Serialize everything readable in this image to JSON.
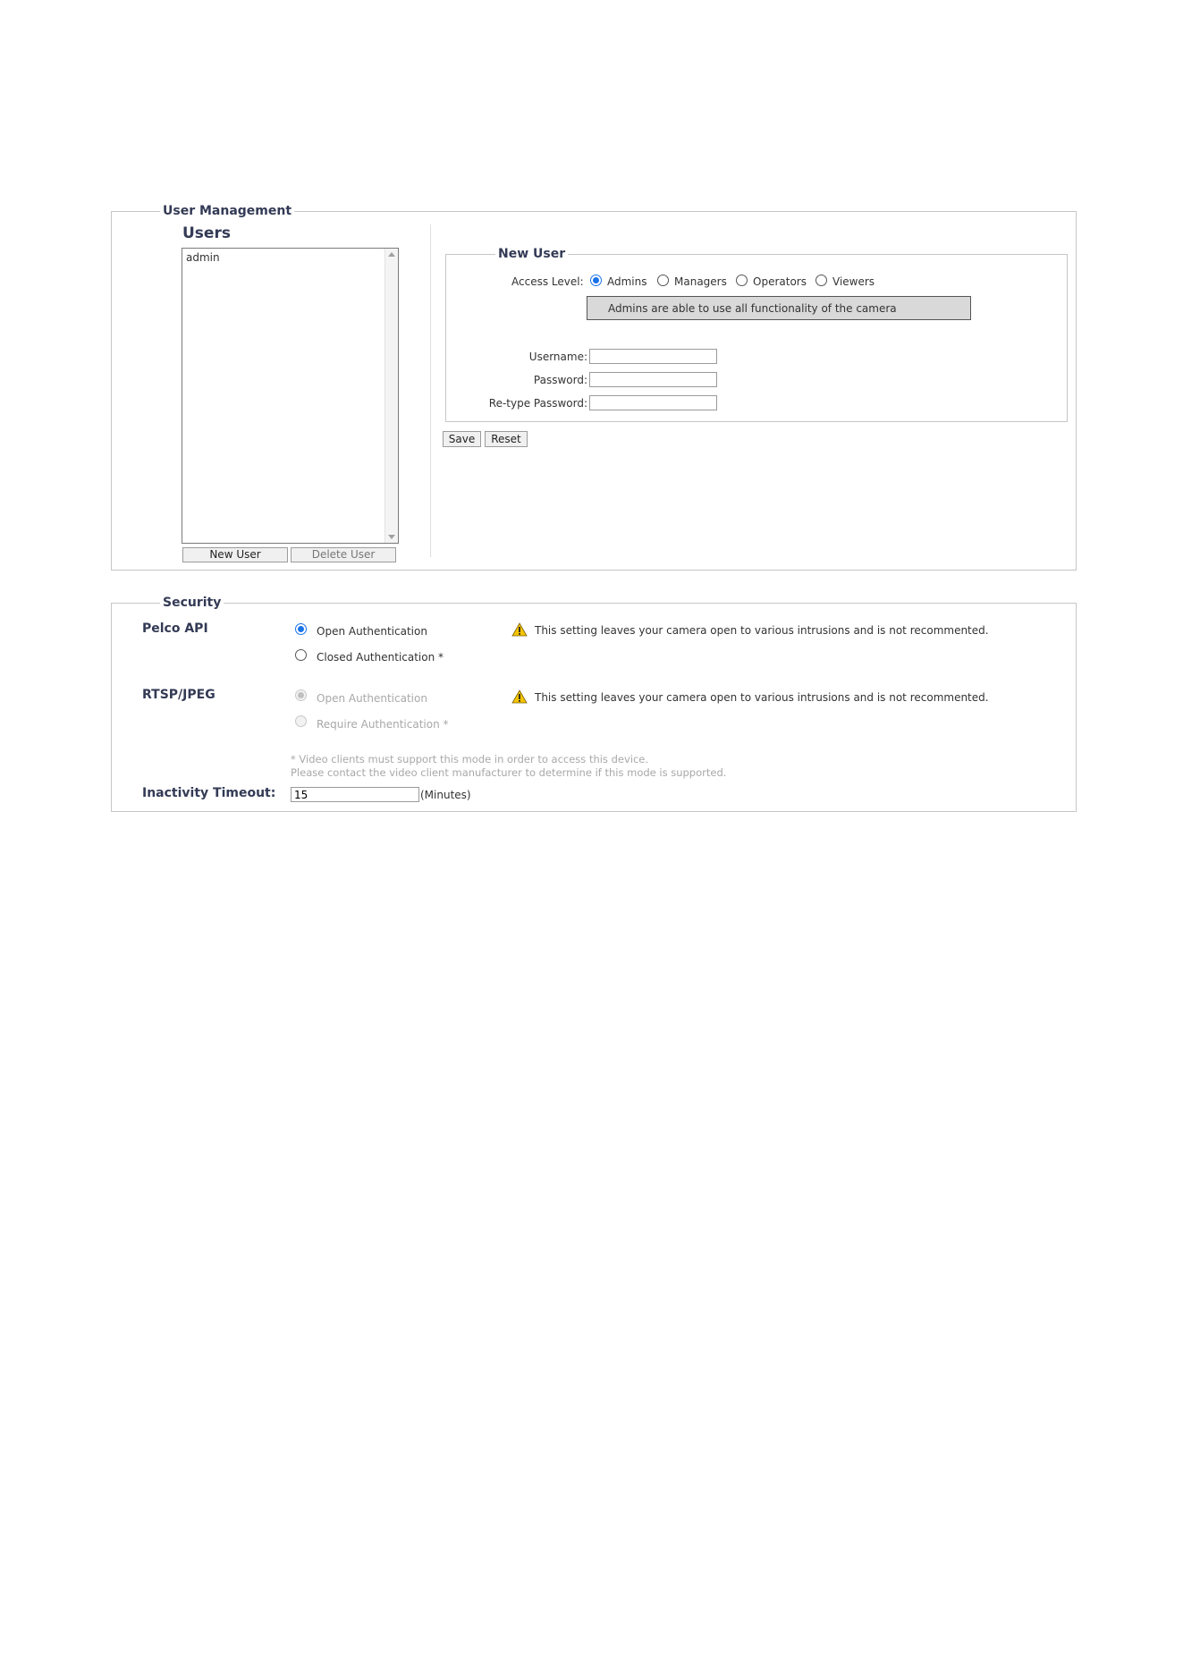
{
  "user_management": {
    "legend": "User Management",
    "users_heading": "Users",
    "users": [
      "admin"
    ],
    "new_user_button": "New User",
    "delete_user_button": "Delete User",
    "new_user": {
      "legend": "New User",
      "access_level_label": "Access Level:",
      "access_levels": [
        "Admins",
        "Managers",
        "Operators",
        "Viewers"
      ],
      "selected_access_level": "Admins",
      "description": "Admins are able to use all functionality of the camera",
      "username_label": "Username:",
      "password_label": "Password:",
      "retype_password_label": "Re-type Password:",
      "username_value": "",
      "password_value": "",
      "retype_password_value": ""
    },
    "save_button": "Save",
    "reset_button": "Reset"
  },
  "security": {
    "legend": "Security",
    "pelco_api": {
      "label": "Pelco API",
      "option_open": "Open Authentication",
      "option_closed": "Closed Authentication *",
      "selected": "Open Authentication",
      "warning": "This setting leaves your camera open to various intrusions and is not recommented."
    },
    "rtsp_jpeg": {
      "label": "RTSP/JPEG",
      "option_open": "Open Authentication",
      "option_require": "Require Authentication *",
      "selected": "Open Authentication",
      "warning": "This setting leaves your camera open to various intrusions and is not recommented."
    },
    "footnote_line1": "* Video clients must support this mode in order to access this device.",
    "footnote_line2": "Please contact the video client manufacturer to determine if this mode is supported.",
    "inactivity_timeout_label": "Inactivity Timeout:",
    "inactivity_timeout_value": "15",
    "inactivity_timeout_unit": "(Minutes)"
  },
  "colors": {
    "accent": "#1a73e8",
    "heading": "#333a55",
    "warning_icon": "#f5c400"
  }
}
